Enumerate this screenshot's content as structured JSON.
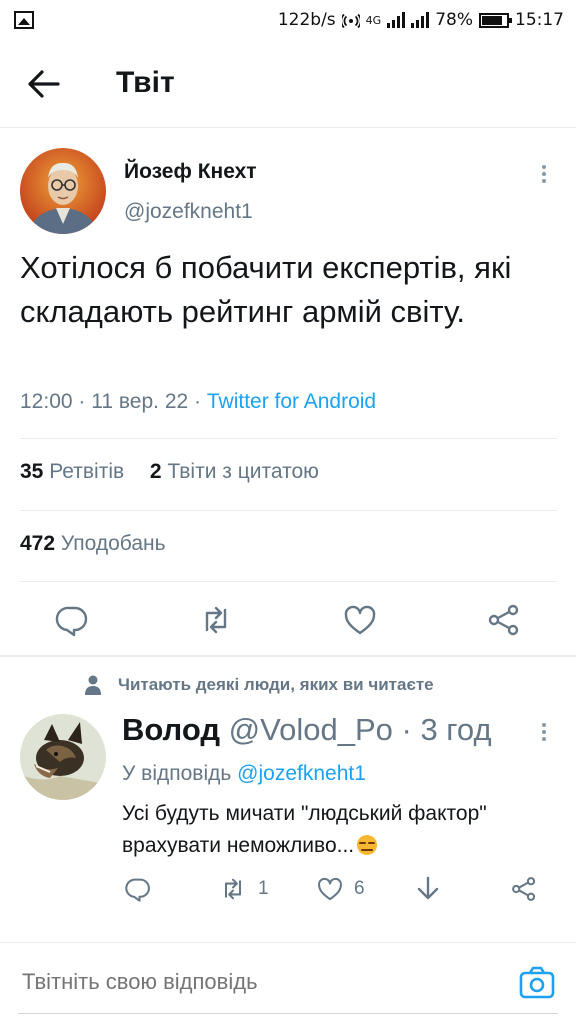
{
  "status_bar": {
    "speed": "122b/s",
    "network": "4G",
    "battery": "78%",
    "time": "15:17"
  },
  "header": {
    "title": "Твіт"
  },
  "tweet": {
    "author_name": "Йозеф Кнехт",
    "author_handle": "@jozefkneht1",
    "text": "Хотілося б побачити експертів, які складають рейтинг армій світу.",
    "time": "12:00",
    "date": "11 вер. 22",
    "source": "Twitter for Android",
    "retweets_count": "35",
    "retweets_label": "Ретвітів",
    "quotes_count": "2",
    "quotes_label": "Твіти з цитатою",
    "likes_count": "472",
    "likes_label": "Уподобань"
  },
  "social_context": {
    "text": "Читають деякі люди, яких ви читаєте"
  },
  "reply": {
    "name": "Волод",
    "handle": "@Volod_Po",
    "time": "3 год",
    "replying_prefix": "У відповідь",
    "replying_to": "@jozefkneht1",
    "text": "Усі будуть мичати \"людський фактор\" врахувати неможливо...",
    "retweets": "1",
    "likes": "6"
  },
  "compose": {
    "placeholder": "Твітніть свою відповідь"
  },
  "colors": {
    "accent": "#1da1f2",
    "secondary_text": "#657786",
    "divider": "#e6ecf0"
  }
}
